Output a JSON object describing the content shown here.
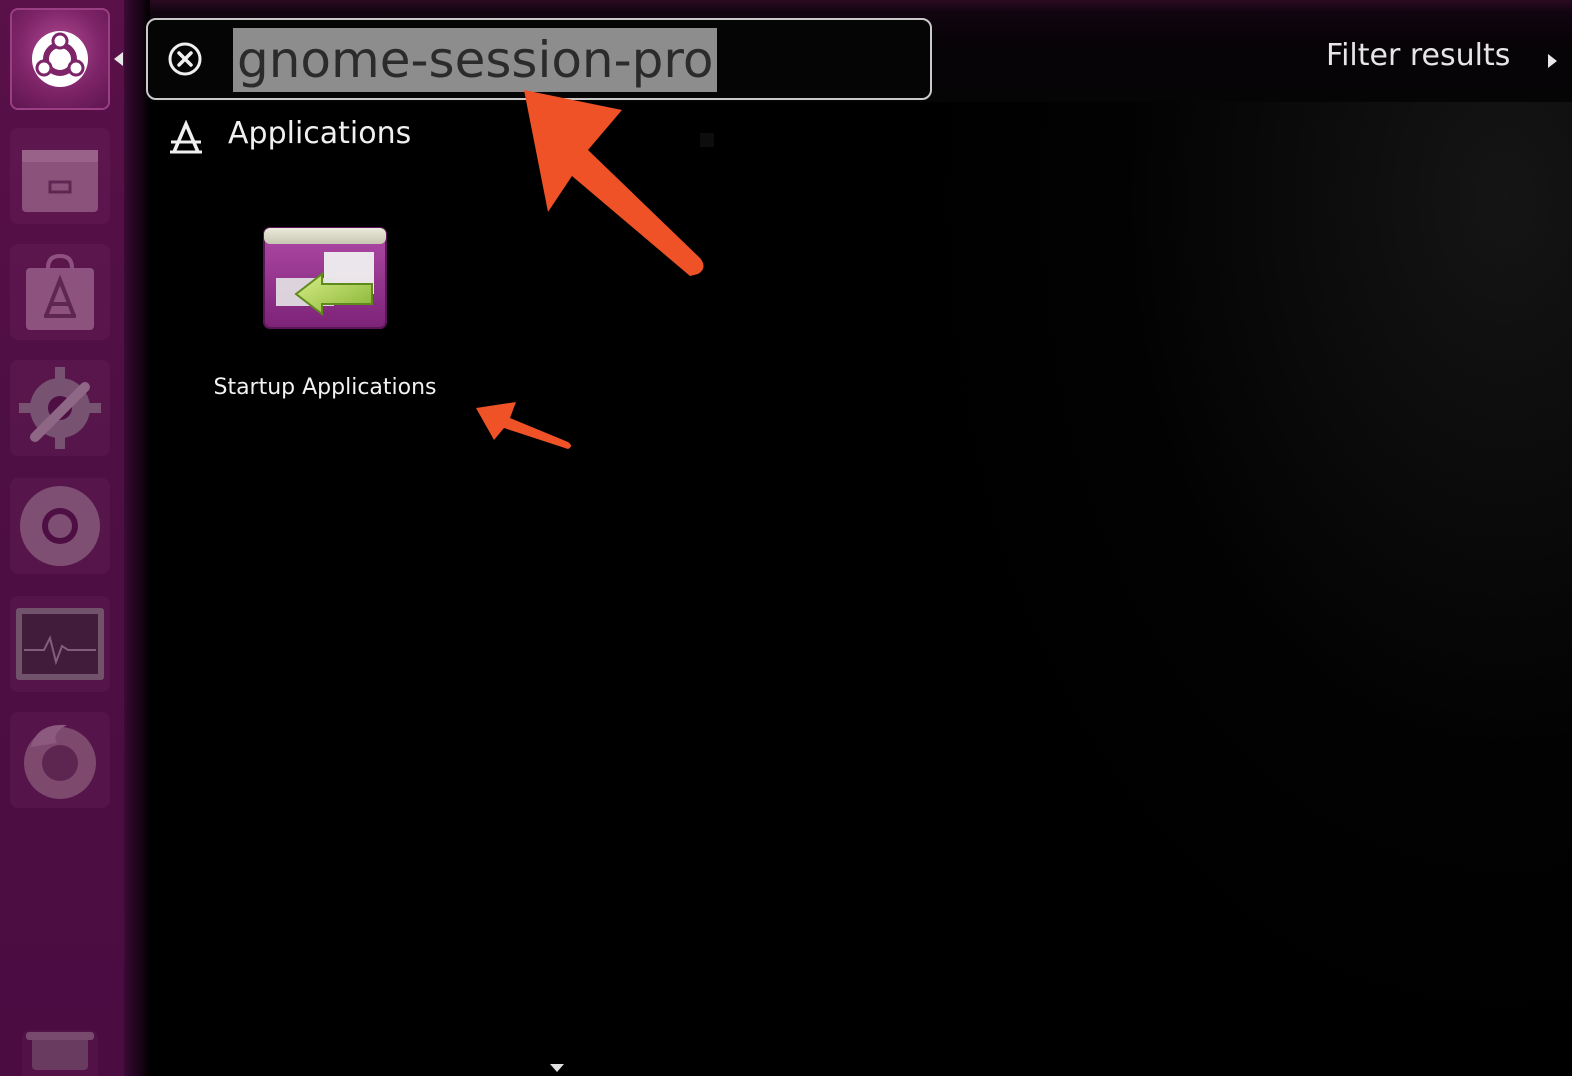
{
  "launcher": {
    "items": [
      {
        "name": "dash-home",
        "icon": "ubuntu-logo-icon"
      },
      {
        "name": "files",
        "icon": "files-icon"
      },
      {
        "name": "software-center",
        "icon": "software-center-icon"
      },
      {
        "name": "system-settings",
        "icon": "settings-icon"
      },
      {
        "name": "chrome",
        "icon": "chrome-icon"
      },
      {
        "name": "system-monitor",
        "icon": "system-monitor-icon"
      },
      {
        "name": "firefox",
        "icon": "firefox-icon"
      },
      {
        "name": "trash",
        "icon": "trash-icon"
      }
    ]
  },
  "search": {
    "query": "gnome-session-pro"
  },
  "filter": {
    "label": "Filter results"
  },
  "results": {
    "category": "Applications",
    "items": [
      {
        "label": "Startup Applications",
        "icon": "startup-applications-icon"
      }
    ]
  },
  "colors": {
    "launcher_bg": "#4e0f44",
    "annotation_arrow": "#ee5226",
    "selection_bg": "#8d8d8d"
  }
}
